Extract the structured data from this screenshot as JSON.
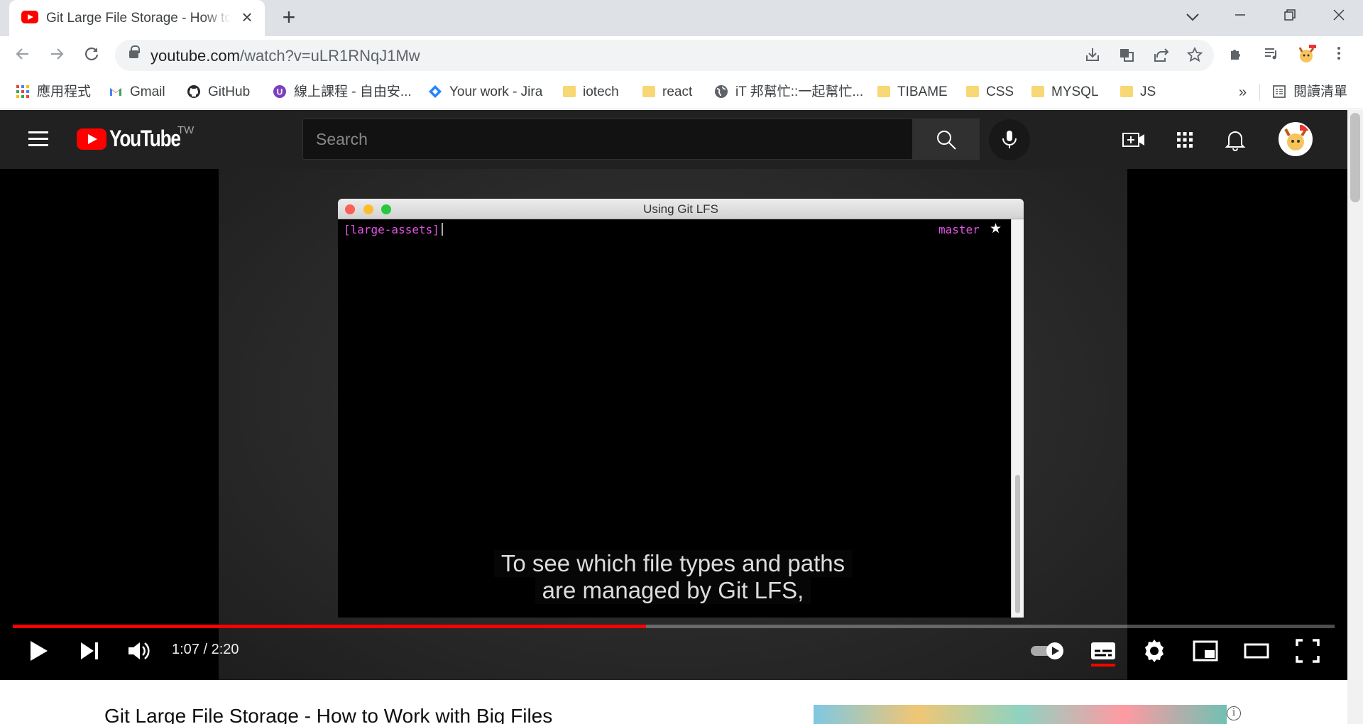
{
  "browser": {
    "tab_title": "Git Large File Storage - How to Work with Big Files",
    "url_host": "youtube.com",
    "url_path": "/watch?v=uLR1RNqJ1Mw"
  },
  "bookmarks": {
    "items": [
      {
        "label": "應用程式",
        "icon": "apps-grid-icon"
      },
      {
        "label": "Gmail",
        "icon": "gmail-icon"
      },
      {
        "label": "GitHub",
        "icon": "github-icon"
      },
      {
        "label": "線上課程 - 自由安...",
        "icon": "course-icon"
      },
      {
        "label": "Your work - Jira",
        "icon": "jira-icon"
      },
      {
        "label": "iotech",
        "icon": "folder-icon"
      },
      {
        "label": "react",
        "icon": "folder-icon"
      },
      {
        "label": "iT 邦幫忙::一起幫忙...",
        "icon": "globe-icon"
      },
      {
        "label": "TIBAME",
        "icon": "folder-icon"
      },
      {
        "label": "CSS",
        "icon": "folder-icon"
      },
      {
        "label": "MYSQL",
        "icon": "folder-icon"
      },
      {
        "label": "JS",
        "icon": "folder-icon"
      }
    ],
    "overflow": "»",
    "reading_list": "閱讀清單"
  },
  "youtube": {
    "logo_text": "YouTube",
    "country": "TW",
    "search_placeholder": "Search"
  },
  "video": {
    "terminal_title": "Using Git LFS",
    "terminal_prompt": "[large-assets]",
    "terminal_branch": "master",
    "terminal_star": "★",
    "caption_line1": "To see which file types and paths",
    "caption_line2": "are managed by Git LFS,",
    "time_display": "1:07 / 2:20",
    "progress_fraction": 0.479,
    "title": "Git Large File Storage - How to Work with Big Files"
  },
  "colors": {
    "accent": "#ff0000",
    "terminal_pink": "#e055e0",
    "yt_header": "#212121"
  }
}
